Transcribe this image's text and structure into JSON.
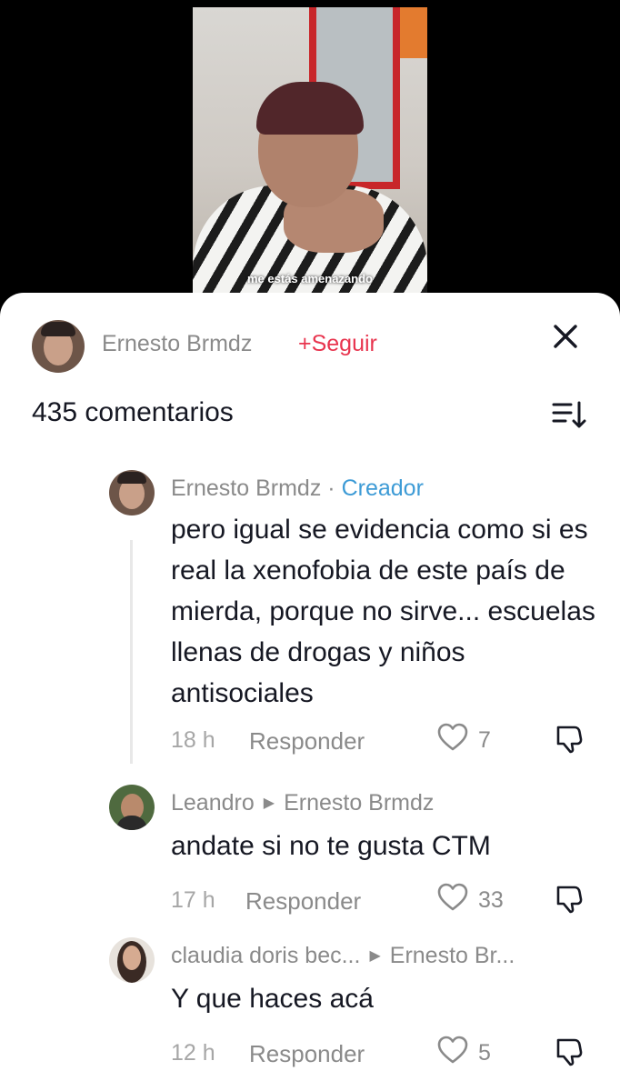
{
  "video": {
    "caption": "me estás amenazando"
  },
  "header": {
    "author_name": "Ernesto Brmdz",
    "follow_label": "+Seguir",
    "close_icon": "close-icon"
  },
  "comments_count_label": "435 comentarios",
  "sort_icon": "sort-icon",
  "comments": [
    {
      "author": "Ernesto Brmdz",
      "separator": "·",
      "badge": "Creador",
      "text": "pero igual se evidencia como si es real la xenofobia de este país de mierda, porque no sirve... escuelas llenas de drogas y niños antisociales",
      "time": "18 h",
      "reply_label": "Responder",
      "likes": "7"
    },
    {
      "author": "Leandro",
      "reply_to": "Ernesto Brmdz",
      "text": "andate si no te gusta CTM",
      "time": "17 h",
      "reply_label": "Responder",
      "likes": "33"
    },
    {
      "author": "claudia doris bec...",
      "reply_to": "Ernesto Br...",
      "text": "Y que haces acá",
      "time": "12 h",
      "reply_label": "Responder",
      "likes": "5"
    }
  ],
  "colors": {
    "follow": "#e8344e",
    "creator_badge": "#3d9bd6",
    "text_primary": "#161823",
    "text_secondary": "#8a8a8a"
  }
}
